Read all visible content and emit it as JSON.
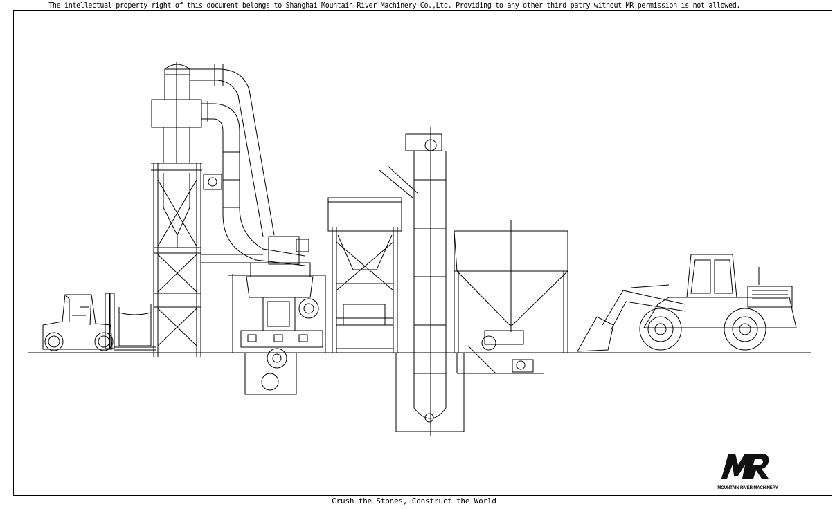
{
  "header": {
    "notice": "The intellectual property right of this document belongs to Shanghai Mountain River Machinery Co.,Ltd. Providing to any other third patry without MR permission is not allowed."
  },
  "footer": {
    "slogan": "Crush the Stones, Construct the World"
  },
  "logo": {
    "company": "MOUNTAIN RIVER MACHINERY"
  },
  "colors": {
    "line": "#000000",
    "background": "#ffffff"
  }
}
